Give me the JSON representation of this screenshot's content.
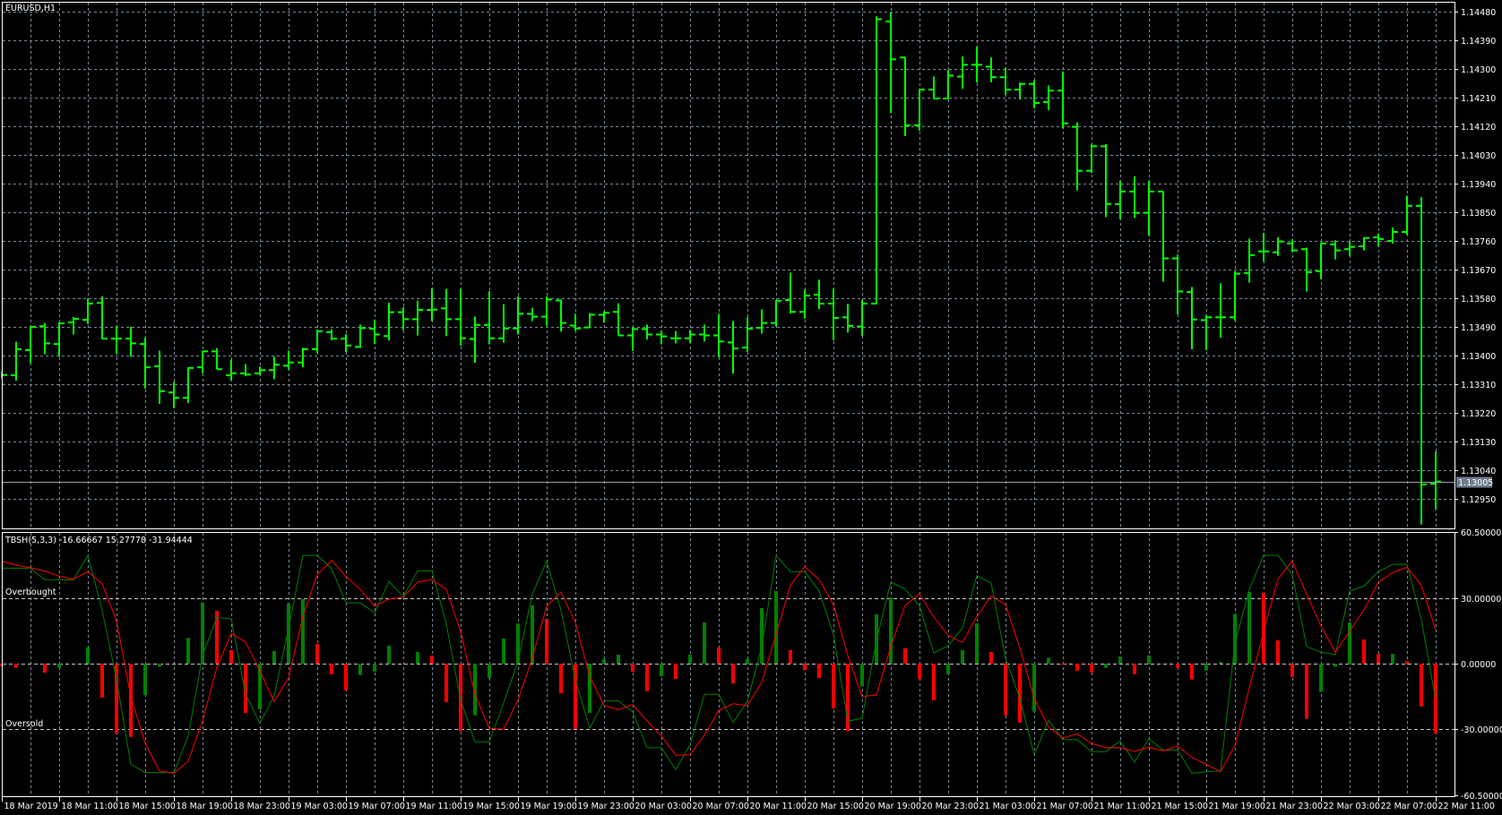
{
  "window": {
    "symbol_label": "EURUSD,H1"
  },
  "indicator": {
    "label": "TBSH(5,3,3) -16.66667 15.27778 -31.94444",
    "overbought_label": "Overbought",
    "oversold_label": "Oversold"
  },
  "colors": {
    "background": "#000000",
    "bars": "#00ff00",
    "grid": "#778899",
    "frame": "#ffffff",
    "main_line": "#008000",
    "signal_line": "#ff0000",
    "hist_up": "#008000",
    "hist_down": "#ff0000",
    "current_price_bg": "#6e7b8b"
  },
  "time_axis": {
    "labels": [
      "18 Mar 2019",
      "18 Mar 11:00",
      "18 Mar 15:00",
      "18 Mar 19:00",
      "18 Mar 23:00",
      "19 Mar 03:00",
      "19 Mar 07:00",
      "19 Mar 11:00",
      "19 Mar 15:00",
      "19 Mar 19:00",
      "19 Mar 23:00",
      "20 Mar 03:00",
      "20 Mar 07:00",
      "20 Mar 11:00",
      "20 Mar 15:00",
      "20 Mar 19:00",
      "20 Mar 23:00",
      "21 Mar 03:00",
      "21 Mar 07:00",
      "21 Mar 11:00",
      "21 Mar 15:00",
      "21 Mar 19:00",
      "21 Mar 23:00",
      "22 Mar 03:00",
      "22 Mar 07:00",
      "22 Mar 11:00"
    ]
  },
  "chart_data": [
    {
      "type": "ohlc",
      "title": "EURUSD,H1",
      "interval": "1 hour",
      "ylim": [
        1.1286,
        1.1452
      ],
      "y_ticks": [
        "1.14480",
        "1.14390",
        "1.14300",
        "1.14210",
        "1.14120",
        "1.14030",
        "1.13940",
        "1.13850",
        "1.13760",
        "1.13670",
        "1.13580",
        "1.13490",
        "1.13400",
        "1.13310",
        "1.13220",
        "1.13130",
        "1.13040",
        "1.12950"
      ],
      "current_price": "1.13005",
      "grid": true,
      "ohlc": [
        [
          1.1334,
          1.1335,
          1.1333,
          1.1334
        ],
        [
          1.13339,
          1.13444,
          1.13322,
          1.13421
        ],
        [
          1.13418,
          1.13493,
          1.13377,
          1.13491
        ],
        [
          1.13493,
          1.13503,
          1.13405,
          1.13439
        ],
        [
          1.13437,
          1.13505,
          1.13397,
          1.13502
        ],
        [
          1.13505,
          1.13522,
          1.13467,
          1.13516
        ],
        [
          1.13513,
          1.1358,
          1.135,
          1.13564
        ],
        [
          1.13566,
          1.13587,
          1.13452,
          1.13454
        ],
        [
          1.13454,
          1.13494,
          1.13407,
          1.13454
        ],
        [
          1.13454,
          1.13491,
          1.13397,
          1.13439
        ],
        [
          1.13437,
          1.13458,
          1.13297,
          1.13364
        ],
        [
          1.13367,
          1.13416,
          1.13249,
          1.13289
        ],
        [
          1.13285,
          1.13318,
          1.13236,
          1.13268
        ],
        [
          1.13268,
          1.13364,
          1.13252,
          1.13362
        ],
        [
          1.13364,
          1.13416,
          1.13346,
          1.13414
        ],
        [
          1.13414,
          1.13424,
          1.13358,
          1.13358
        ],
        [
          1.13339,
          1.13388,
          1.13322,
          1.13345
        ],
        [
          1.13345,
          1.13374,
          1.13336,
          1.13341
        ],
        [
          1.13345,
          1.13366,
          1.13339,
          1.13355
        ],
        [
          1.13355,
          1.13397,
          1.13327,
          1.13372
        ],
        [
          1.13369,
          1.13416,
          1.13357,
          1.13379
        ],
        [
          1.13379,
          1.13425,
          1.13364,
          1.13421
        ],
        [
          1.13421,
          1.13483,
          1.13409,
          1.13477
        ],
        [
          1.13474,
          1.13483,
          1.13449,
          1.13454
        ],
        [
          1.13454,
          1.13468,
          1.13411,
          1.13432
        ],
        [
          1.13428,
          1.13498,
          1.13425,
          1.13487
        ],
        [
          1.13485,
          1.13514,
          1.13437,
          1.13467
        ],
        [
          1.13462,
          1.13567,
          1.13448,
          1.13537
        ],
        [
          1.13537,
          1.13553,
          1.13481,
          1.13515
        ],
        [
          1.13515,
          1.13573,
          1.13464,
          1.13544
        ],
        [
          1.13544,
          1.13612,
          1.13509,
          1.13545
        ],
        [
          1.13549,
          1.1361,
          1.13462,
          1.13515
        ],
        [
          1.13515,
          1.1361,
          1.13432,
          1.13455
        ],
        [
          1.13453,
          1.13523,
          1.13378,
          1.13497
        ],
        [
          1.13497,
          1.13603,
          1.13436,
          1.13455
        ],
        [
          1.13455,
          1.13562,
          1.13441,
          1.13486
        ],
        [
          1.13486,
          1.13586,
          1.13467,
          1.13532
        ],
        [
          1.13532,
          1.13551,
          1.13509,
          1.13523
        ],
        [
          1.13523,
          1.13587,
          1.13495,
          1.13577
        ],
        [
          1.13574,
          1.13577,
          1.13476,
          1.13503
        ],
        [
          1.13495,
          1.13532,
          1.13479,
          1.13486
        ],
        [
          1.13489,
          1.13534,
          1.13489,
          1.13529
        ],
        [
          1.13529,
          1.1354,
          1.13504,
          1.13535
        ],
        [
          1.13538,
          1.13565,
          1.13464,
          1.13464
        ],
        [
          1.13464,
          1.13488,
          1.13415,
          1.13484
        ],
        [
          1.13484,
          1.13498,
          1.13451,
          1.13467
        ],
        [
          1.13467,
          1.13479,
          1.13436,
          1.13461
        ],
        [
          1.13455,
          1.13478,
          1.13439,
          1.13455
        ],
        [
          1.13455,
          1.13481,
          1.13441,
          1.13467
        ],
        [
          1.13467,
          1.13498,
          1.13445,
          1.13464
        ],
        [
          1.13464,
          1.13532,
          1.13395,
          1.13445
        ],
        [
          1.13442,
          1.13509,
          1.13344,
          1.13423
        ],
        [
          1.13426,
          1.13521,
          1.13412,
          1.13485
        ],
        [
          1.13488,
          1.13546,
          1.1347,
          1.13503
        ],
        [
          1.13503,
          1.13575,
          1.13492,
          1.13573
        ],
        [
          1.13575,
          1.13661,
          1.13533,
          1.13538
        ],
        [
          1.13538,
          1.13608,
          1.13517,
          1.13589
        ],
        [
          1.13592,
          1.13639,
          1.13547,
          1.13564
        ],
        [
          1.13564,
          1.13611,
          1.13449,
          1.13519
        ],
        [
          1.13521,
          1.13563,
          1.13473,
          1.13494
        ],
        [
          1.13492,
          1.13575,
          1.13463,
          1.13564
        ],
        [
          1.13564,
          1.14466,
          1.13564,
          1.14457
        ],
        [
          1.1445,
          1.14478,
          1.14163,
          1.14331
        ],
        [
          1.14337,
          1.14337,
          1.1409,
          1.14124
        ],
        [
          1.14124,
          1.14239,
          1.14107,
          1.14236
        ],
        [
          1.14236,
          1.14277,
          1.14207,
          1.14208
        ],
        [
          1.14208,
          1.14298,
          1.14207,
          1.1428
        ],
        [
          1.14277,
          1.1434,
          1.14239,
          1.14314
        ],
        [
          1.14314,
          1.14371,
          1.14258,
          1.14314
        ],
        [
          1.14308,
          1.14337,
          1.14259,
          1.14275
        ],
        [
          1.14275,
          1.14305,
          1.14219,
          1.14236
        ],
        [
          1.14236,
          1.14258,
          1.14205,
          1.14254
        ],
        [
          1.14254,
          1.14265,
          1.14177,
          1.14194
        ],
        [
          1.14197,
          1.14249,
          1.14172,
          1.14233
        ],
        [
          1.14233,
          1.14293,
          1.14114,
          1.1413
        ],
        [
          1.14119,
          1.14133,
          1.1392,
          1.13981
        ],
        [
          1.13981,
          1.14065,
          1.13974,
          1.14058
        ],
        [
          1.14058,
          1.14065,
          1.13836,
          1.13877
        ],
        [
          1.13876,
          1.1395,
          1.13829,
          1.13916
        ],
        [
          1.13916,
          1.13964,
          1.13833,
          1.13849
        ],
        [
          1.13849,
          1.1395,
          1.13777,
          1.13916
        ],
        [
          1.13916,
          1.13916,
          1.13633,
          1.13706
        ],
        [
          1.13706,
          1.13718,
          1.1353,
          1.13602
        ],
        [
          1.136,
          1.13616,
          1.13421,
          1.13514
        ],
        [
          1.13512,
          1.13528,
          1.13418,
          1.13521
        ],
        [
          1.13521,
          1.13628,
          1.13457,
          1.13521
        ],
        [
          1.13521,
          1.13666,
          1.13511,
          1.13658
        ],
        [
          1.1366,
          1.13768,
          1.1363,
          1.13716
        ],
        [
          1.13728,
          1.13786,
          1.13696,
          1.13728
        ],
        [
          1.13725,
          1.13772,
          1.13714,
          1.13759
        ],
        [
          1.13753,
          1.13766,
          1.13726,
          1.13731
        ],
        [
          1.13735,
          1.1374,
          1.13602,
          1.13663
        ],
        [
          1.13666,
          1.13756,
          1.13641,
          1.13753
        ],
        [
          1.1375,
          1.13763,
          1.13703,
          1.13731
        ],
        [
          1.13735,
          1.13759,
          1.13714,
          1.13742
        ],
        [
          1.13744,
          1.13772,
          1.13731,
          1.1377
        ],
        [
          1.13772,
          1.13784,
          1.13744,
          1.13767
        ],
        [
          1.13761,
          1.13803,
          1.13753,
          1.13789
        ],
        [
          1.13789,
          1.13903,
          1.1378,
          1.13871
        ],
        [
          1.13871,
          1.13898,
          1.1287,
          1.12996
        ],
        [
          1.12998,
          1.131,
          1.12918,
          1.13005
        ]
      ]
    },
    {
      "type": "line+histogram",
      "title": "TBSH(5,3,3)",
      "ylim": [
        -60.5,
        60.5
      ],
      "y_ticks": [
        "60.50000",
        "30.00000",
        "0.00000",
        "-30.00000",
        "-60.50000"
      ],
      "levels": [
        30,
        0,
        -30
      ],
      "series": [
        {
          "values": [
            43.8,
            43.8,
            43.8,
            38.5,
            38.5,
            38.5,
            49.7,
            24.4,
            -7.1,
            -46.2,
            -50,
            -50,
            -50,
            -33.2,
            3.8,
            21.2,
            20.5,
            -14,
            -27.4,
            -14.7,
            16.2,
            49.7,
            49.7,
            43.6,
            27.9,
            27.9,
            23.3,
            37.7,
            30.8,
            42.6,
            42.6,
            18.2,
            -16.7,
            -35.9,
            -35.9,
            -18.1,
            1.1,
            31.9,
            47,
            24.4,
            -7.1,
            -29.7,
            -17.1,
            -17.1,
            -22.2,
            -38.6,
            -38.6,
            -48.6,
            -37.3,
            -14.1,
            -14.1,
            -27,
            -17.4,
            7.9,
            49.5,
            42.2,
            42.2,
            33.3,
            13.4,
            -26.3,
            -25.2,
            10.7,
            37.4,
            34.2,
            26.4,
            4.9,
            8.2,
            16.4,
            40.4,
            37,
            2.5,
            -16,
            -41.8,
            -26,
            -34.9,
            -34.9,
            -40.4,
            -40.4,
            -35.5,
            -45.2,
            -34.5,
            -39.7,
            -39.6,
            -50.3,
            -49.6,
            -49.2,
            9.3,
            34,
            49.7,
            49.7,
            40.8,
            7.9,
            5.2,
            4.1,
            33.3,
            35.6,
            42.2,
            45.6,
            45.6,
            20.3,
            -16.66667
          ],
          "color": "#008000"
        },
        {
          "values": [
            47,
            45.2,
            44,
            42.5,
            40.1,
            38.8,
            42.2,
            36.7,
            19.6,
            -15.3,
            -36.6,
            -49.2,
            -50.3,
            -44.8,
            -26.3,
            -1.6,
            13.8,
            10,
            -3.3,
            -17.4,
            -6.4,
            21.6,
            40.8,
            47.4,
            40.1,
            34,
            26.4,
            29.6,
            30.5,
            37.4,
            38.5,
            34.2,
            14.8,
            -14,
            -29.7,
            -30.1,
            -16.7,
            2.5,
            26.4,
            32.9,
            18.9,
            -5.8,
            -19.2,
            -21.1,
            -18.8,
            -26.3,
            -33.2,
            -42,
            -41.8,
            -32.9,
            -21.5,
            -18.4,
            -19.2,
            -8.5,
            13.4,
            36,
            44.5,
            38.6,
            27.1,
            3.8,
            -15.1,
            -14.4,
            7.9,
            26.7,
            32,
            21.4,
            13,
            9.7,
            21.6,
            31,
            27.1,
            7.3,
            -16,
            -29,
            -34.2,
            -32.2,
            -36.6,
            -38.6,
            -38.6,
            -40.3,
            -38.4,
            -40,
            -37.9,
            -43,
            -46.2,
            -49.6,
            -37.5,
            -11.2,
            14.8,
            38.8,
            47,
            31.9,
            17.3,
            5.2,
            14.8,
            24.7,
            37.4,
            41.8,
            44.2,
            36,
            15.27778
          ],
          "color": "#ff0000"
        }
      ],
      "histogram": [
        -1,
        -1.9,
        0,
        -4.1,
        -1.9,
        0,
        7.5,
        -15.5,
        -32,
        -33.6,
        -14.4,
        -1.4,
        0,
        11.8,
        28,
        24.2,
        6.2,
        -22.6,
        -21,
        5.8,
        27.7,
        29.6,
        9,
        -4.8,
        -12.2,
        -5.2,
        -3.6,
        8.2,
        0,
        5.3,
        3.7,
        -17.7,
        -31,
        -23.7,
        -6.6,
        11.5,
        18.4,
        26.7,
        20.5,
        -13.6,
        -30,
        -22.6,
        2.1,
        4.1,
        -3.7,
        -12.7,
        -5.8,
        -7,
        4.1,
        18.9,
        7.4,
        -9,
        2.1,
        25.5,
        33.3,
        6.2,
        -3,
        -6.6,
        -20.5,
        -31,
        -10.5,
        22.6,
        30.5,
        7,
        -7,
        -16.8,
        -4.8,
        6.2,
        18.5,
        5.3,
        -23.7,
        -27.1,
        -22,
        2.7,
        -0.5,
        -3.2,
        -4,
        -1.9,
        3.3,
        -4.8,
        3.8,
        0,
        -1.9,
        -7.3,
        -3.2,
        0.8,
        22.7,
        32.9,
        32.5,
        10.7,
        -6.2,
        -25.3,
        -13,
        -1.4,
        18.9,
        11.1,
        4.5,
        4.5,
        1.1,
        -19.6,
        -31.94444
      ]
    }
  ]
}
